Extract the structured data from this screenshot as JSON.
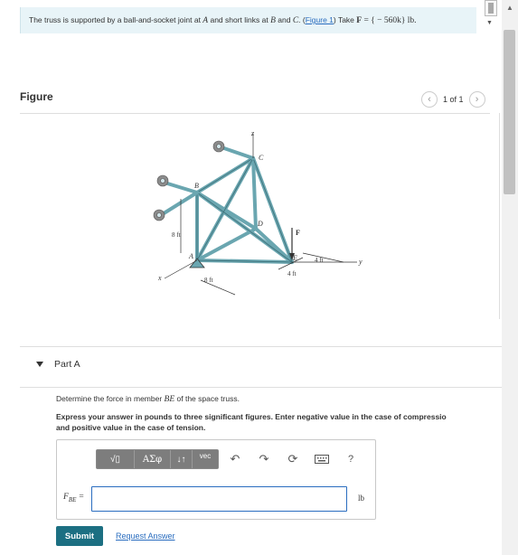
{
  "problem": {
    "text_before": "The truss is supported by a ball-and-socket joint at ",
    "joint_a": "A",
    "text_mid": " and short links at ",
    "joint_b": "B",
    "text_and": " and ",
    "joint_c": "C",
    "text_period": ". (",
    "figure_link": "Figure 1",
    "text_after": ") Take ",
    "force_symbol": "F",
    "force_value": " = { − 560k} lb."
  },
  "figure": {
    "title": "Figure",
    "pager_text": "1 of 1",
    "prev_icon": "chevron-left-icon",
    "next_icon": "chevron-right-icon",
    "labels": {
      "z": "z",
      "C": "C",
      "B": "B",
      "D": "D",
      "F": "F",
      "A": "A",
      "E": "E",
      "x": "x",
      "y": "y",
      "dim_8ft_vertical": "8 ft",
      "dim_8ft_bottom": "8 ft",
      "dim_4ft_right": "4 ft",
      "dim_4ft_bottom": "4 ft"
    }
  },
  "partA": {
    "title": "Part A",
    "question_before": "Determine the force in member ",
    "member": "BE",
    "question_after": " of the space truss.",
    "instructions": "Express your answer in pounds to three significant figures. Enter negative value in the case of compressio and positive value in the case of tension.",
    "instructions_line1": "Express your answer in pounds to three significant figures. Enter negative value in the case of compressio",
    "instructions_line2": "and positive value in the case of tension.",
    "toolbar": {
      "templates": "√▯",
      "greek": "ΑΣφ",
      "arrows": "↓↑",
      "vec": "vec",
      "undo_icon": "undo-icon",
      "redo_icon": "redo-icon",
      "reset_icon": "reset-icon",
      "keyboard_icon": "keyboard-icon",
      "help": "?"
    },
    "answer_label_main": "F",
    "answer_label_sub": "BE",
    "answer_label_eq": " =",
    "answer_value": "",
    "unit": "lb",
    "submit": "Submit",
    "request": "Request Answer"
  }
}
